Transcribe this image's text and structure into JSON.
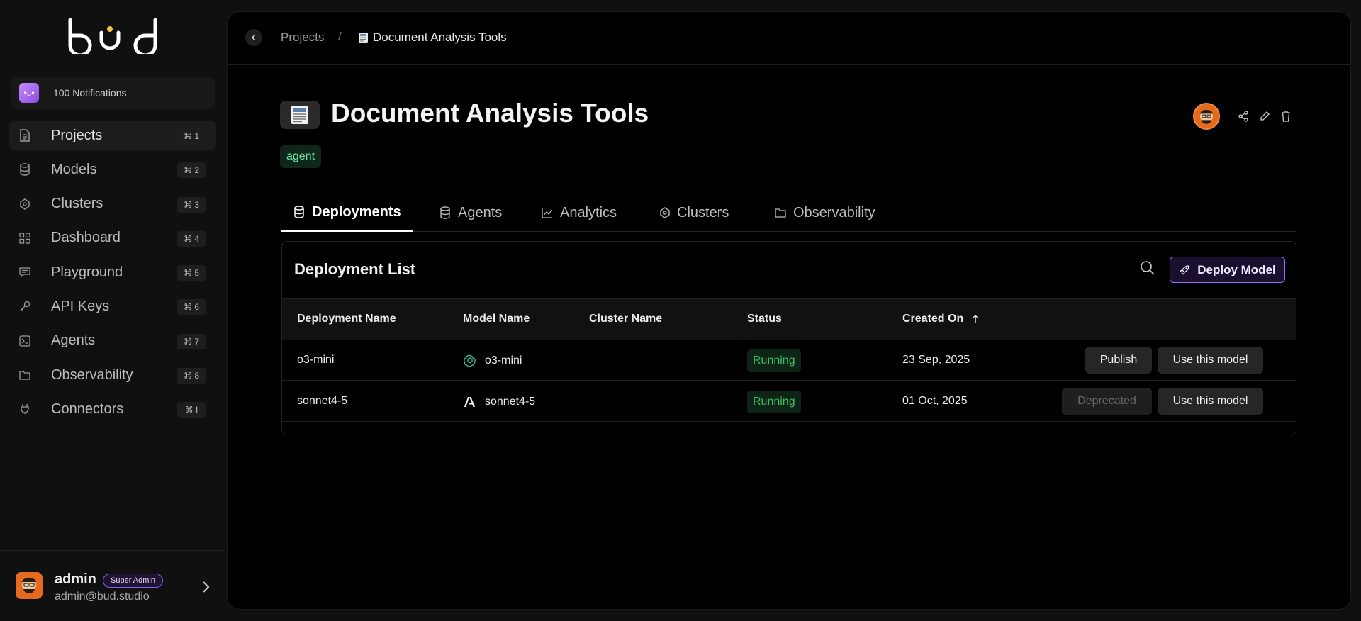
{
  "app": {
    "logo_text": "bud"
  },
  "notifications": {
    "label": "100 Notifications"
  },
  "sidebar": {
    "items": [
      {
        "label": "Projects",
        "shortcut": "⌘ 1",
        "icon": "document-icon",
        "active": true
      },
      {
        "label": "Models",
        "shortcut": "⌘ 2",
        "icon": "database-icon",
        "active": false
      },
      {
        "label": "Clusters",
        "shortcut": "⌘ 3",
        "icon": "cluster-icon",
        "active": false
      },
      {
        "label": "Dashboard",
        "shortcut": "⌘ 4",
        "icon": "grid-icon",
        "active": false
      },
      {
        "label": "Playground",
        "shortcut": "⌘ 5",
        "icon": "chat-icon",
        "active": false
      },
      {
        "label": "API Keys",
        "shortcut": "⌘ 6",
        "icon": "key-icon",
        "active": false
      },
      {
        "label": "Agents",
        "shortcut": "⌘ 7",
        "icon": "terminal-icon",
        "active": false
      },
      {
        "label": "Observability",
        "shortcut": "⌘ 8",
        "icon": "folder-icon",
        "active": false
      },
      {
        "label": "Connectors",
        "shortcut": "⌘ I",
        "icon": "plug-icon",
        "active": false
      }
    ]
  },
  "user": {
    "name": "admin",
    "role_badge": "Super Admin",
    "email": "admin@bud.studio"
  },
  "breadcrumb": {
    "parent": "Projects",
    "separator": "/",
    "current": "Document Analysis Tools"
  },
  "project": {
    "title": "Document Analysis Tools",
    "tag": "agent"
  },
  "tabs": [
    {
      "label": "Deployments",
      "icon": "database-icon",
      "active": true
    },
    {
      "label": "Agents",
      "icon": "database-icon",
      "active": false
    },
    {
      "label": "Analytics",
      "icon": "chart-icon",
      "active": false
    },
    {
      "label": "Clusters",
      "icon": "cluster-icon",
      "active": false
    },
    {
      "label": "Observability",
      "icon": "folder-icon",
      "active": false
    }
  ],
  "deployments": {
    "title": "Deployment List",
    "deploy_button": "Deploy Model",
    "columns": [
      "Deployment Name",
      "Model Name",
      "Cluster Name",
      "Status",
      "Created On"
    ],
    "sort_column": "Created On",
    "rows": [
      {
        "deployment": "o3-mini",
        "model": "o3-mini",
        "model_icon": "openai-icon",
        "cluster": "",
        "status": "Running",
        "created": "23 Sep, 2025",
        "action1": "Publish",
        "action1_disabled": false,
        "action2": "Use this model"
      },
      {
        "deployment": "sonnet4-5",
        "model": "sonnet4-5",
        "model_icon": "anthropic-icon",
        "cluster": "",
        "status": "Running",
        "created": "01 Oct, 2025",
        "action1": "Deprecated",
        "action1_disabled": true,
        "action2": "Use this model"
      }
    ]
  },
  "colors": {
    "accent_purple": "#9b6bff",
    "status_green": "#3fbf63",
    "tag_green": "#6ee7a8"
  }
}
